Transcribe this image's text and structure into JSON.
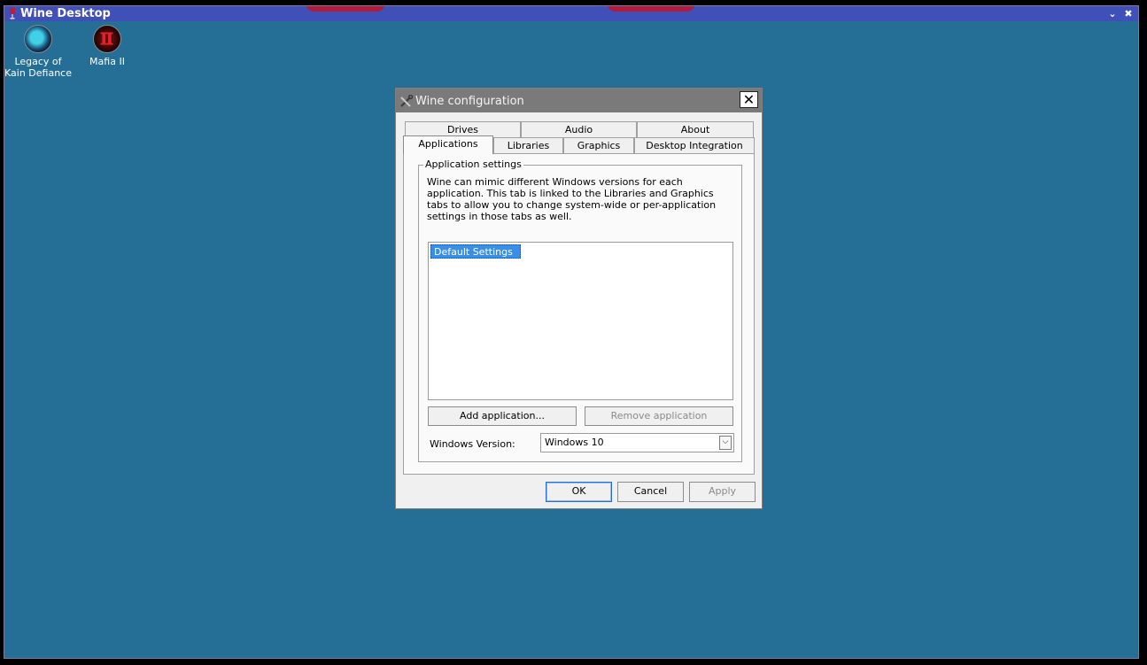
{
  "desktop": {
    "title": "Wine Desktop",
    "minimize_glyph": "⌄",
    "close_glyph": "✖",
    "icons": [
      {
        "label": "Legacy of Kain Defiance",
        "icon": "legacy-of-kain-icon"
      },
      {
        "label": "Mafia II",
        "icon": "mafia-ii-icon"
      }
    ]
  },
  "dialog": {
    "title": "Wine configuration",
    "close_glyph": "✕",
    "tabs_back": [
      "Drives",
      "Audio",
      "About"
    ],
    "tabs_front": [
      "Applications",
      "Libraries",
      "Graphics",
      "Desktop Integration"
    ],
    "active_tab": "Applications",
    "group_title": "Application settings",
    "description": "Wine can mimic different Windows versions for each application. This tab is linked to the Libraries and Graphics tabs to allow you to change system-wide or per-application settings in those tabs as well.",
    "app_list": [
      "Default Settings"
    ],
    "add_button": "Add application...",
    "remove_button": "Remove application",
    "windows_version_label": "Windows Version:",
    "windows_version_value": "Windows 10",
    "ok_button": "OK",
    "cancel_button": "Cancel",
    "apply_button": "Apply"
  },
  "colors": {
    "desktop_background": "#256f96",
    "desktop_titlebar": "#4150b8",
    "selection": "#3a8ee6"
  }
}
